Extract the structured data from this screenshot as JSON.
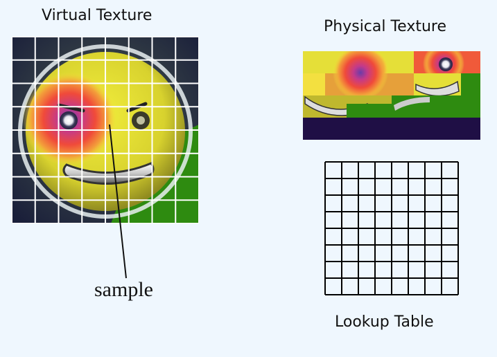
{
  "virtual_texture": {
    "title": "Virtual Texture",
    "grid_size": 8
  },
  "physical_texture": {
    "title": "Physical Texture"
  },
  "lookup_table": {
    "title": "Lookup Table",
    "grid_size": 8
  },
  "annotation": {
    "label": "sample"
  },
  "colors": {
    "background": "#eff7fe",
    "grid_line": "#ffffff",
    "lookup_line": "#000000",
    "dark_tile": "#1f0f45",
    "yellow": "#e8e23a",
    "green": "#2e8b10",
    "red": "#e6403a",
    "purple": "#7a2b8f"
  }
}
